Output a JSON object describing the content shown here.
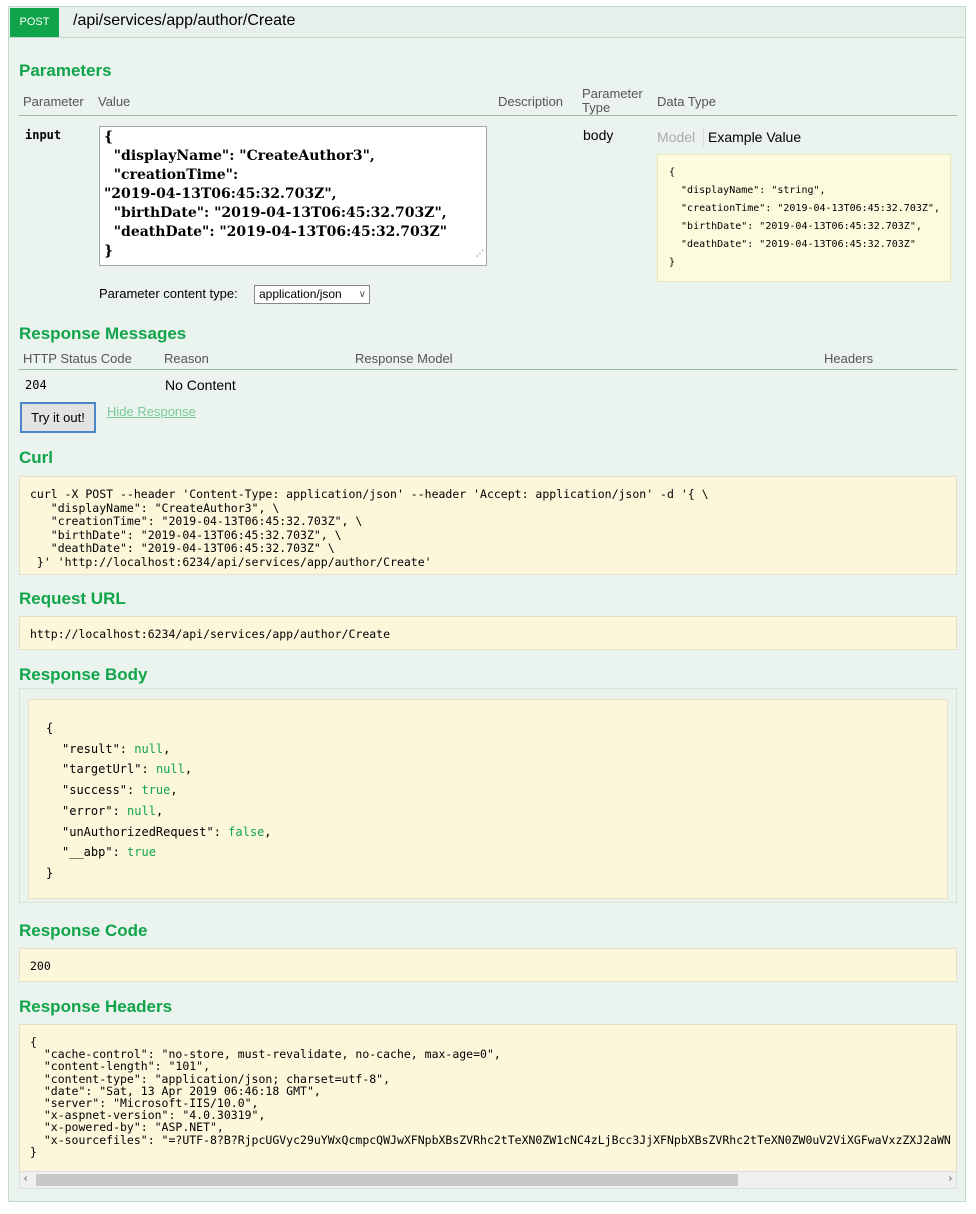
{
  "operation": {
    "method": "POST",
    "path": "/api/services/app/author/Create"
  },
  "parameters": {
    "title": "Parameters",
    "headers": {
      "parameter": "Parameter",
      "value": "Value",
      "description": "Description",
      "param_type_1": "Parameter",
      "param_type_2": "Type",
      "data_type": "Data Type"
    },
    "row": {
      "name": "input",
      "value_lines": [
        "{",
        "  \"displayName\": \"CreateAuthor3\",",
        "  \"creationTime\":",
        "\"2019-04-13T06:45:32.703Z\",",
        "  \"birthDate\": \"2019-04-13T06:45:32.703Z\",",
        "  \"deathDate\": \"2019-04-13T06:45:32.703Z\"",
        "}"
      ],
      "param_type": "body",
      "model_tab": "Model",
      "example_tab": "Example Value",
      "example_lines": [
        "{",
        "  \"displayName\": \"string\",",
        "  \"creationTime\": \"2019-04-13T06:45:32.703Z\",",
        "  \"birthDate\": \"2019-04-13T06:45:32.703Z\",",
        "  \"deathDate\": \"2019-04-13T06:45:32.703Z\"",
        "}"
      ]
    },
    "content_type_label": "Parameter content type:",
    "content_type_value": "application/json"
  },
  "response_messages": {
    "title": "Response Messages",
    "headers": {
      "status": "HTTP Status Code",
      "reason": "Reason",
      "model": "Response Model",
      "headers": "Headers"
    },
    "row": {
      "status": "204",
      "reason": "No Content"
    }
  },
  "actions": {
    "try_label": "Try it out!",
    "hide_label": "Hide Response"
  },
  "curl": {
    "title": "Curl",
    "lines": [
      "curl -X POST --header 'Content-Type: application/json' --header 'Accept: application/json' -d '{ \\",
      "   \"displayName\": \"CreateAuthor3\", \\",
      "   \"creationTime\": \"2019-04-13T06:45:32.703Z\", \\",
      "   \"birthDate\": \"2019-04-13T06:45:32.703Z\", \\",
      "   \"deathDate\": \"2019-04-13T06:45:32.703Z\" \\",
      " }' 'http://localhost:6234/api/services/app/author/Create'"
    ]
  },
  "request_url": {
    "title": "Request URL",
    "value": "http://localhost:6234/api/services/app/author/Create"
  },
  "response_body": {
    "title": "Response Body",
    "open": "{",
    "close": "}",
    "entries": [
      {
        "key": "\"result\"",
        "value": "null",
        "sep": ","
      },
      {
        "key": "\"targetUrl\"",
        "value": "null",
        "sep": ","
      },
      {
        "key": "\"success\"",
        "value": "true",
        "sep": ","
      },
      {
        "key": "\"error\"",
        "value": "null",
        "sep": ","
      },
      {
        "key": "\"unAuthorizedRequest\"",
        "value": "false",
        "sep": ","
      },
      {
        "key": "\"__abp\"",
        "value": "true",
        "sep": ""
      }
    ]
  },
  "response_code": {
    "title": "Response Code",
    "value": "200"
  },
  "response_headers": {
    "title": "Response Headers",
    "lines": [
      "{",
      "  \"cache-control\": \"no-store, must-revalidate, no-cache, max-age=0\",",
      "  \"content-length\": \"101\",",
      "  \"content-type\": \"application/json; charset=utf-8\",",
      "  \"date\": \"Sat, 13 Apr 2019 06:46:18 GMT\",",
      "  \"server\": \"Microsoft-IIS/10.0\",",
      "  \"x-aspnet-version\": \"4.0.30319\",",
      "  \"x-powered-by\": \"ASP.NET\",",
      "  \"x-sourcefiles\": \"=?UTF-8?B?RjpcUGVyc29uYWxQcmpcQWJwXFNpbXBsZVRhc2tTeXN0ZW1cNC4zLjBcc3JjXFNpbXBsZVRhc2tTeXN0ZW0uV2ViXGFwaVxzZXJ2aWN",
      "}"
    ]
  },
  "scrollbar": {
    "left_arrow": "‹",
    "right_arrow": "›"
  }
}
